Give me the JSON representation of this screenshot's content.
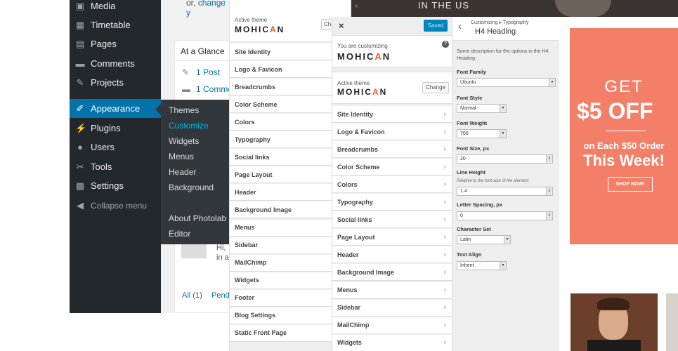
{
  "wp_menu": {
    "items": [
      {
        "label": "Media",
        "icon": "media-icon",
        "glyph": "▣"
      },
      {
        "label": "Timetable",
        "icon": "timetable-icon",
        "glyph": "▦"
      },
      {
        "label": "Pages",
        "icon": "pages-icon",
        "glyph": "▤"
      },
      {
        "label": "Comments",
        "icon": "comments-icon",
        "glyph": "▬"
      },
      {
        "label": "Projects",
        "icon": "pin-icon",
        "glyph": "✎"
      },
      {
        "label": "Appearance",
        "icon": "brush-icon",
        "glyph": "✐"
      },
      {
        "label": "Plugins",
        "icon": "plug-icon",
        "glyph": "⚡"
      },
      {
        "label": "Users",
        "icon": "users-icon",
        "glyph": "●"
      },
      {
        "label": "Tools",
        "icon": "wrench-icon",
        "glyph": "✂"
      },
      {
        "label": "Settings",
        "icon": "settings-icon",
        "glyph": "▩"
      }
    ],
    "collapse": "Collapse menu",
    "submenu": [
      "Themes",
      "Customize",
      "Widgets",
      "Menus",
      "Header",
      "Background",
      "About Photolab",
      "Editor"
    ]
  },
  "dashboard": {
    "top_text": "or,",
    "top_link": "change y",
    "glance_title": "At a Glance",
    "post_count": "1 Post",
    "comment_count": "1 Comme",
    "hi_text": "Hi,",
    "in_text": "in a",
    "all_label": "All",
    "all_count": "(1)",
    "pend": "Pend"
  },
  "panel_left": {
    "active_theme_label": "Active theme",
    "theme_name_a": "MOHIC",
    "theme_accent": "A",
    "theme_name_b": "N",
    "change_btn": "Chan",
    "items": [
      "Site Identity",
      "Logo & Favicon",
      "Breadcrumbs",
      "Color Scheme",
      "Colors",
      "Typography",
      "Social links",
      "Page Layout",
      "Header",
      "Background Image",
      "Menus",
      "Sidebar",
      "MailChimp",
      "Widgets",
      "Footer",
      "Blog Settings",
      "Static Front Page"
    ]
  },
  "panel_mid": {
    "close": "×",
    "saved": "Saved",
    "customizing_label": "You are customizing",
    "help": "?",
    "active_theme_label": "Active theme",
    "change_btn": "Change",
    "items": [
      "Site Identity",
      "Logo & Favicon",
      "Breadcrumbs",
      "Color Scheme",
      "Colors",
      "Typography",
      "Social links",
      "Page Layout",
      "Header",
      "Background Image",
      "Menus",
      "Sidebar",
      "MailChimp",
      "Widgets"
    ]
  },
  "typography": {
    "back": "‹",
    "breadcrumb": "Customizing ▸ Typography",
    "title": "H4 Heading",
    "description": "Some description for the options in the H4 Heading",
    "font_family_label": "Font Family",
    "font_family": "Ubuntu",
    "font_style_label": "Font Style",
    "font_style": "Normal",
    "font_weight_label": "Font Weight",
    "font_weight": "700",
    "font_size_label": "Font Size, px",
    "font_size": "20",
    "line_height_label": "Line Height",
    "line_height_hint": "Relative to the font-size of the element",
    "line_height": "1.4",
    "letter_spacing_label": "Letter Spacing, px",
    "letter_spacing": "0",
    "charset_label": "Character Set",
    "charset": "Latin",
    "align_label": "Text Align",
    "align": "Inherit"
  },
  "preview": {
    "banner": "IN THE US",
    "promo_get": "GET",
    "promo_amount": "$5 OFF",
    "promo_sub": "on Each $50 Order",
    "promo_week": "This Week!",
    "promo_btn": "SHOP NOW!"
  },
  "colors": {
    "wp_dark": "#23282d",
    "wp_blue": "#0073aa",
    "promo": "#f47f68",
    "accent": "#e85c2a",
    "saved": "#0085ba"
  }
}
